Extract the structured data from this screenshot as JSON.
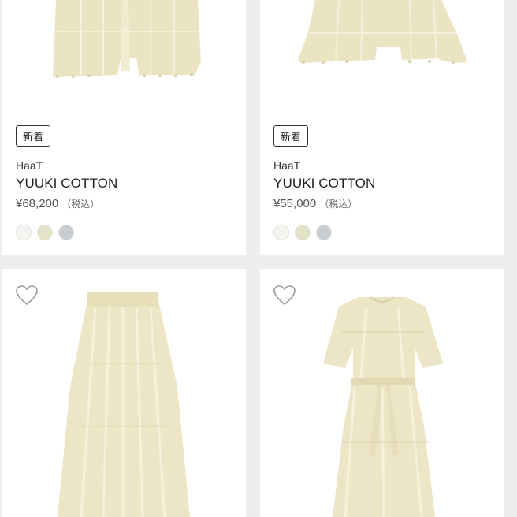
{
  "products": [
    {
      "badge": "新着",
      "brand": "HaaT",
      "name": "YUUKI COTTON",
      "price": "¥68,200",
      "tax": "（税込）",
      "swatches": [
        "#f4f4f0",
        "#e2e3c8",
        "#c9cdd1"
      ],
      "garment": "jacket"
    },
    {
      "badge": "新着",
      "brand": "HaaT",
      "name": "YUUKI COTTON",
      "price": "¥55,000",
      "tax": "（税込）",
      "swatches": [
        "#f4f4f0",
        "#e2e3c8",
        "#c9cdd1"
      ],
      "garment": "cape"
    },
    {
      "garment": "skirt",
      "icon": "heart-icon"
    },
    {
      "garment": "dress",
      "icon": "heart-icon"
    }
  ]
}
